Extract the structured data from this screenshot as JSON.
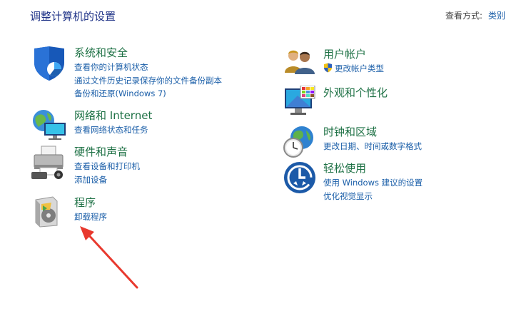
{
  "header": {
    "title": "调整计算机的设置",
    "view_label": "查看方式:",
    "view_value": "类别"
  },
  "categories": [
    {
      "id": "system",
      "title": "系统和安全",
      "icon": "shield-icon",
      "links": [
        "查看你的计算机状态",
        "通过文件历史记录保存你的文件备份副本",
        "备份和还原(Windows 7)"
      ]
    },
    {
      "id": "network",
      "title": "网络和 Internet",
      "icon": "globe-network-icon",
      "links": [
        "查看网络状态和任务"
      ]
    },
    {
      "id": "hardware",
      "title": "硬件和声音",
      "icon": "printer-icon",
      "links": [
        "查看设备和打印机",
        "添加设备"
      ]
    },
    {
      "id": "programs",
      "title": "程序",
      "icon": "program-disc-icon",
      "links": [
        "卸载程序"
      ]
    },
    {
      "id": "users",
      "title": "用户帐户",
      "icon": "users-icon",
      "links": [
        "更改帐户类型"
      ]
    },
    {
      "id": "appearance",
      "title": "外观和个性化",
      "icon": "monitor-palette-icon",
      "links": []
    },
    {
      "id": "clock",
      "title": "时钟和区域",
      "icon": "clock-globe-icon",
      "links": [
        "更改日期、时间或数字格式"
      ]
    },
    {
      "id": "ease",
      "title": "轻松使用",
      "icon": "ease-of-access-icon",
      "links": [
        "使用 Windows 建议的设置",
        "优化视觉显示"
      ]
    }
  ],
  "colors": {
    "title": "#1e7145",
    "link": "#1a5ea8",
    "header": "#1e3287",
    "arrow": "#e8392e"
  }
}
